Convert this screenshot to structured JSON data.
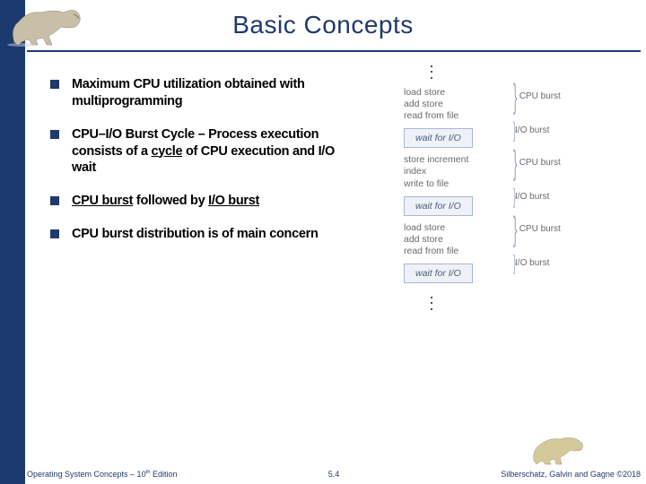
{
  "title": "Basic Concepts",
  "bullets": [
    {
      "text": "Maximum CPU utilization obtained with multiprogramming"
    },
    {
      "text": "CPU–I/O Burst Cycle – Process execution consists of a cycle of CPU execution and I/O wait"
    },
    {
      "text": "CPU burst followed by I/O burst"
    },
    {
      "text": "CPU burst distribution is of main concern"
    }
  ],
  "diagram": {
    "ops": [
      "load store\nadd store\nread from file",
      "store increment\nindex\nwrite to file",
      "load store\nadd store\nread from file"
    ],
    "wait_label": "wait for I/O",
    "brace_labels": {
      "cpu": "CPU burst",
      "io": "I/O burst"
    }
  },
  "footer": {
    "left_a": "Operating System Concepts – 10",
    "left_sup": "th",
    "left_b": " Edition",
    "mid": "5.4",
    "right": "Silberschatz, Galvin and Gagne ©2018"
  },
  "icons": {
    "dino_top": "dinosaur-illustration",
    "dino_bot": "dinosaur-illustration"
  }
}
